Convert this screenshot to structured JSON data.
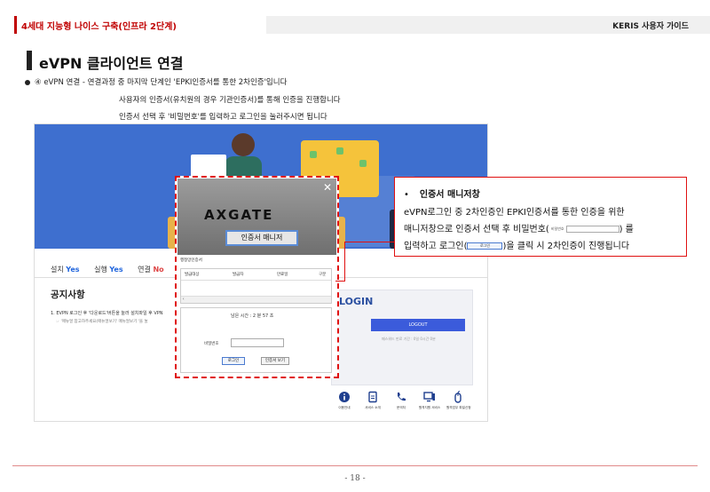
{
  "header": {
    "left": "4세대 지능형 나이스 구축(인프라 2단계)",
    "right": "KERIS 사용자 가이드"
  },
  "title": "eVPN 클라이언트 연결",
  "bullet": {
    "line1": "④ eVPN 연결 - 연결과정 중 마지막 단계인 'EPKI인증서를 통한 2차인증'입니다",
    "line2": "사용자의 인증서(유치원의 경우 기관인증서)를 통해 인증을 진행합니다",
    "line3": "인증서 선택 후 '비밀번호'를 입력하고 로그인을 눌러주시면 됩니다"
  },
  "screenshot": {
    "status": {
      "install_label": "설치",
      "install_value": "Yes",
      "run_label": "실행",
      "run_value": "Yes",
      "connect_label": "연결",
      "connect_value": "No"
    },
    "notice_title": "공지사항",
    "notice_1": "1. EVPN 로그인 후 '다운로드'버튼을 눌러 설치파일 후 VPN",
    "notice_2": "☞ '매뉴얼 참고하주세요(매뉴얼보기' 매뉴얼보기 '을 눌",
    "login_title": "LOGIN",
    "logout_label": "LOGOUT",
    "login_sub": "패스워드 만료 기간 : 0일 0시간 0분",
    "services": [
      "이용안내",
      "서비스 소개",
      "문의처",
      "원격지원 서비스",
      "원격업무 파일신청"
    ]
  },
  "dialog": {
    "close": "✕",
    "logo": "AXGATE",
    "button": "인증서 매니저",
    "tab": "행정망인증서",
    "columns": [
      "발급대상",
      "발급자",
      "만료일",
      "구분"
    ],
    "remain": "남은 시간 : 2 분 57 초",
    "pw_label": "비밀번호",
    "login_btn": "로그인",
    "view_btn": "인증서 보기"
  },
  "callout": {
    "bullet": "•",
    "title": "인증서 매니저창",
    "line1": "eVPN로그인 중 2차인증인 EPKI인증서를 통한 인증을 위한",
    "line2_a": "매니저창으로 인증서 선택 후 비밀번호(",
    "line2_label": "비밀번호",
    "line2_b": ") 를",
    "line3_a": "입력하고 로그인(",
    "line3_btn": "로그인",
    "line3_b": ")을 클릭 시 2차인증이 진행됩니다"
  },
  "page_number": "- 18 -",
  "colors": {
    "accent_red": "#c00000",
    "login_blue": "#3b5bdb"
  }
}
